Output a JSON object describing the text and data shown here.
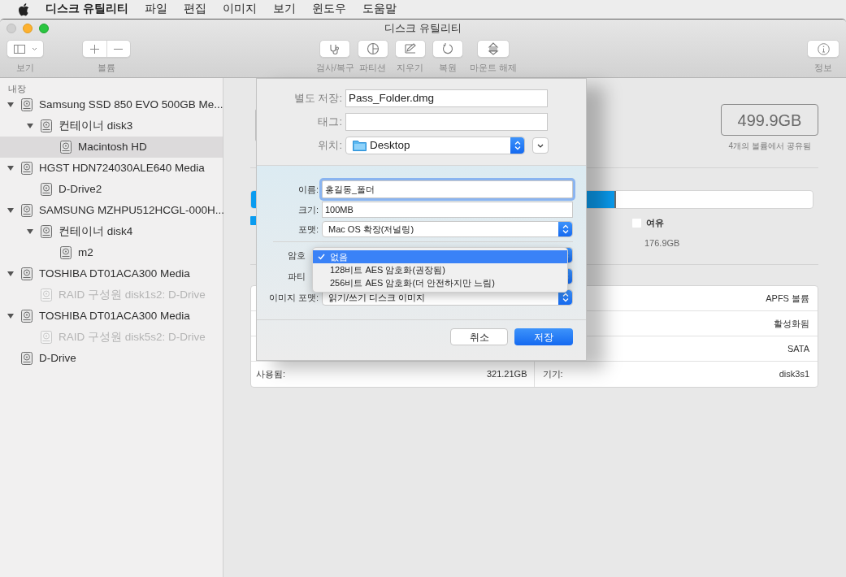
{
  "menubar": {
    "app": "디스크 유틸리티",
    "items": [
      "파일",
      "편집",
      "이미지",
      "보기",
      "윈도우",
      "도움말"
    ]
  },
  "window": {
    "title": "디스크 유틸리티"
  },
  "toolbar": {
    "view_label": "보기",
    "volume_label": "볼륨",
    "actions": [
      {
        "label": "검사/복구",
        "kind": "firstaid"
      },
      {
        "label": "파티션",
        "kind": "partition"
      },
      {
        "label": "지우기",
        "kind": "erase"
      },
      {
        "label": "복원",
        "kind": "restore"
      },
      {
        "label": "마운트 해제",
        "kind": "unmount"
      }
    ],
    "info_label": "정보"
  },
  "sidebar": {
    "section": "내장",
    "items": [
      {
        "label": "Samsung SSD 850 EVO 500GB Me...",
        "expanded": true,
        "selected": false,
        "disabled": false,
        "children": [
          {
            "label": "컨테이너 disk3",
            "expanded": true,
            "selected": false,
            "disabled": false,
            "children": [
              {
                "label": "Macintosh HD",
                "selected": true,
                "disabled": false
              }
            ]
          }
        ]
      },
      {
        "label": "HGST HDN724030ALE640 Media",
        "expanded": true,
        "selected": false,
        "disabled": false,
        "children": [
          {
            "label": "D-Drive2",
            "selected": false,
            "disabled": false
          }
        ]
      },
      {
        "label": "SAMSUNG MZHPU512HCGL-000H...",
        "expanded": true,
        "selected": false,
        "disabled": false,
        "children": [
          {
            "label": "컨테이너 disk4",
            "expanded": true,
            "selected": false,
            "disabled": false,
            "children": [
              {
                "label": "m2",
                "selected": false,
                "disabled": false
              }
            ]
          }
        ]
      },
      {
        "label": "TOSHIBA DT01ACA300 Media",
        "expanded": true,
        "selected": false,
        "disabled": false,
        "children": [
          {
            "label": "RAID 구성원 disk1s2: D-Drive",
            "selected": false,
            "disabled": true
          }
        ]
      },
      {
        "label": "TOSHIBA DT01ACA300 Media",
        "expanded": true,
        "selected": false,
        "disabled": false,
        "children": [
          {
            "label": "RAID 구성원 disk5s2: D-Drive",
            "selected": false,
            "disabled": true
          }
        ]
      },
      {
        "label": "D-Drive",
        "selected": false,
        "disabled": false
      }
    ]
  },
  "main": {
    "capacity": "499.9GB",
    "capacity_note": "4개의 볼륨에서 공유됨",
    "usage": {
      "level": 0.65
    },
    "legend": [
      {
        "color": "#0a9cf0"
      },
      {
        "label": "여유",
        "value": "176.9GB",
        "color": "#ffffff"
      }
    ],
    "info_rows": [
      {
        "right_value": "APFS 볼륨"
      },
      {
        "right_value": "활성화됨"
      },
      {
        "right_value": "SATA"
      },
      {
        "left_label": "사용됨:",
        "left_value": "321.21GB",
        "right_label": "기기:",
        "right_value": "disk3s1"
      }
    ]
  },
  "dialog": {
    "save_as": {
      "label": "별도 저장:",
      "value": "Pass_Folder.dmg"
    },
    "tags": {
      "label": "태그:"
    },
    "where": {
      "label": "위치:",
      "value": "Desktop"
    },
    "name": {
      "label": "이름:",
      "value": "홍길동_폴더"
    },
    "size": {
      "label": "크기:",
      "value": "100MB"
    },
    "format": {
      "label": "포맷:",
      "value": "Mac OS 확장(저널링)"
    },
    "encryption": {
      "label": "암호"
    },
    "partition": {
      "label": "파티"
    },
    "image_format": {
      "label": "이미지 포맷:",
      "value": "읽기/쓰기 디스크 이미지"
    },
    "menu": [
      {
        "label": "없음",
        "selected": true
      },
      {
        "label": "128비트 AES 암호화(권장됨)",
        "selected": false
      },
      {
        "label": "256비트 AES 암호화(더 안전하지만 느림)",
        "selected": false
      }
    ],
    "buttons": {
      "cancel": "취소",
      "save": "저장"
    }
  }
}
